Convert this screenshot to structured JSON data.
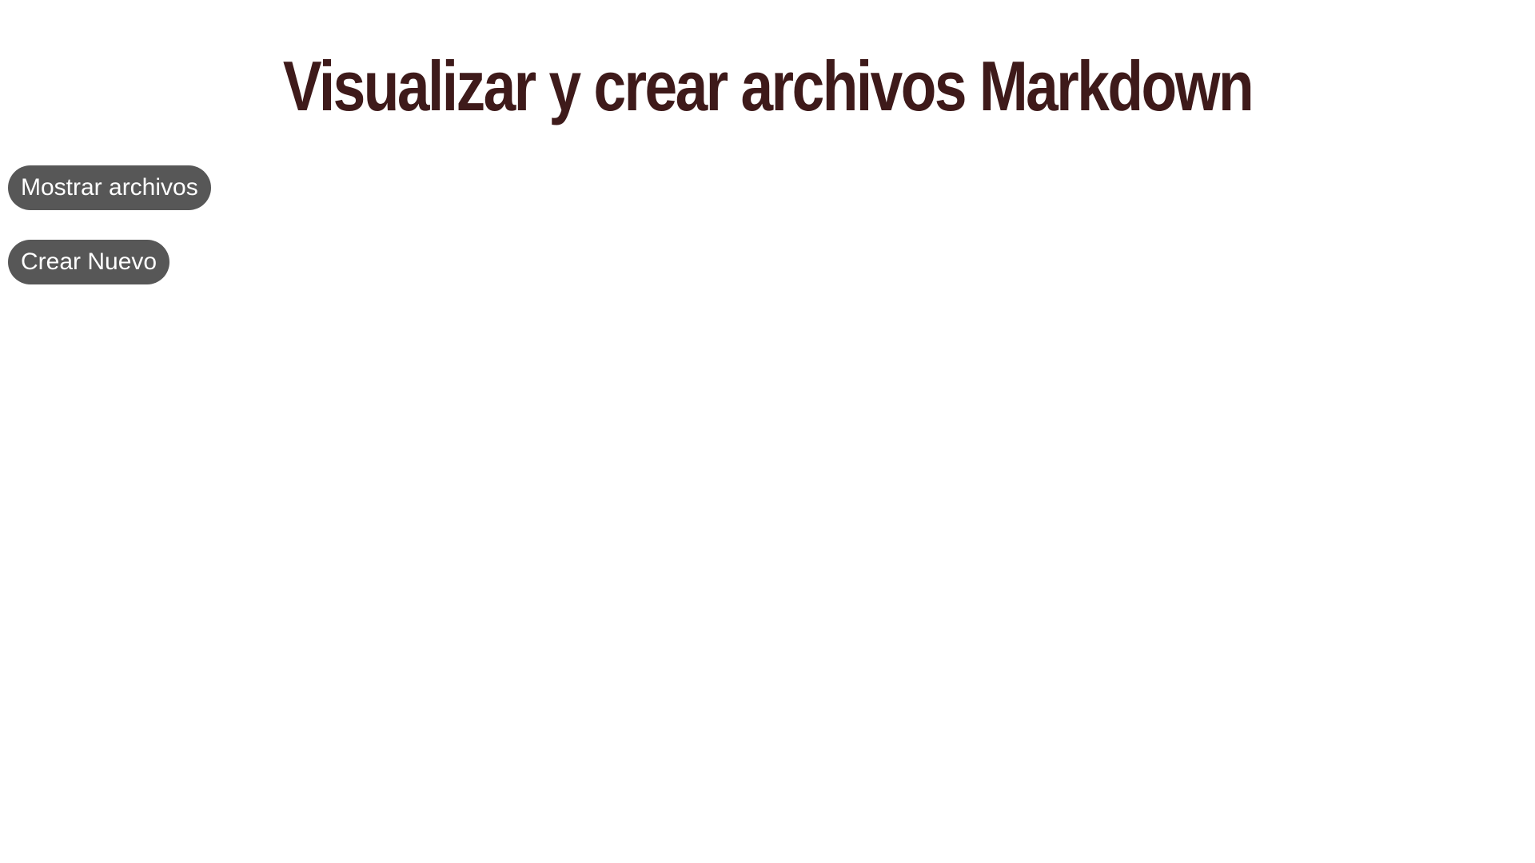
{
  "header": {
    "title": "Visualizar y crear archivos Markdown"
  },
  "actions": {
    "show_files_label": "Mostrar archivos",
    "create_new_label": "Crear Nuevo"
  },
  "colors": {
    "title": "#3e1a1a",
    "button_background": "#575757",
    "button_text": "#ffffff",
    "page_background": "#ffffff"
  }
}
